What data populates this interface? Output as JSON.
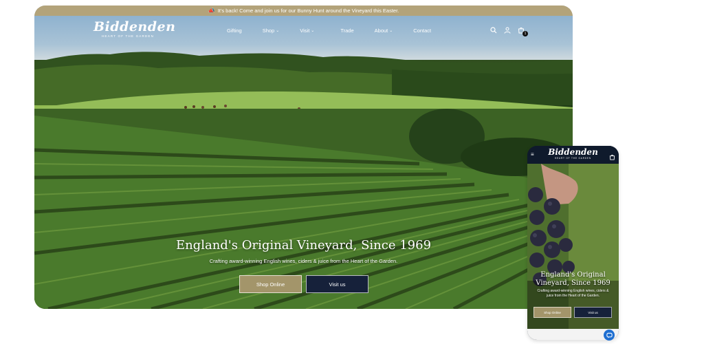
{
  "announcement": {
    "icon": "megaphone-icon",
    "text": "It's back! Come and join us for our Bunny Hunt around the Vineyard this Easter."
  },
  "brand": {
    "name": "Biddenden",
    "tagline": "HEART OF THE GARDEN"
  },
  "nav": {
    "items": [
      {
        "label": "Gifting",
        "dropdown": false
      },
      {
        "label": "Shop",
        "dropdown": true
      },
      {
        "label": "Visit",
        "dropdown": true
      },
      {
        "label": "Trade",
        "dropdown": false
      },
      {
        "label": "About",
        "dropdown": true
      },
      {
        "label": "Contact",
        "dropdown": false
      }
    ],
    "icons": [
      "search-icon",
      "account-icon",
      "cart-icon"
    ],
    "cart_count": "1"
  },
  "hero": {
    "title": "England's Original Vineyard, Since 1969",
    "subtitle": "Crafting award-winning English wines, ciders & juice from the Heart of the Garden.",
    "primary_button": "Shop Online",
    "secondary_button": "Visit us"
  },
  "mobile": {
    "title_line1": "England's Original",
    "title_line2": "Vineyard, Since 1969",
    "subtitle": "Crafting award-winning English wines, ciders & juice from the Heart of the Garden.",
    "primary_button": "Shop Online",
    "secondary_button": "Visit us"
  },
  "colors": {
    "announcement_bg": "#b3a37a",
    "primary_button": "#a3956a",
    "secondary_button": "#16213a",
    "mobile_header": "#0f1a2c",
    "chat": "#1f6fd1"
  }
}
